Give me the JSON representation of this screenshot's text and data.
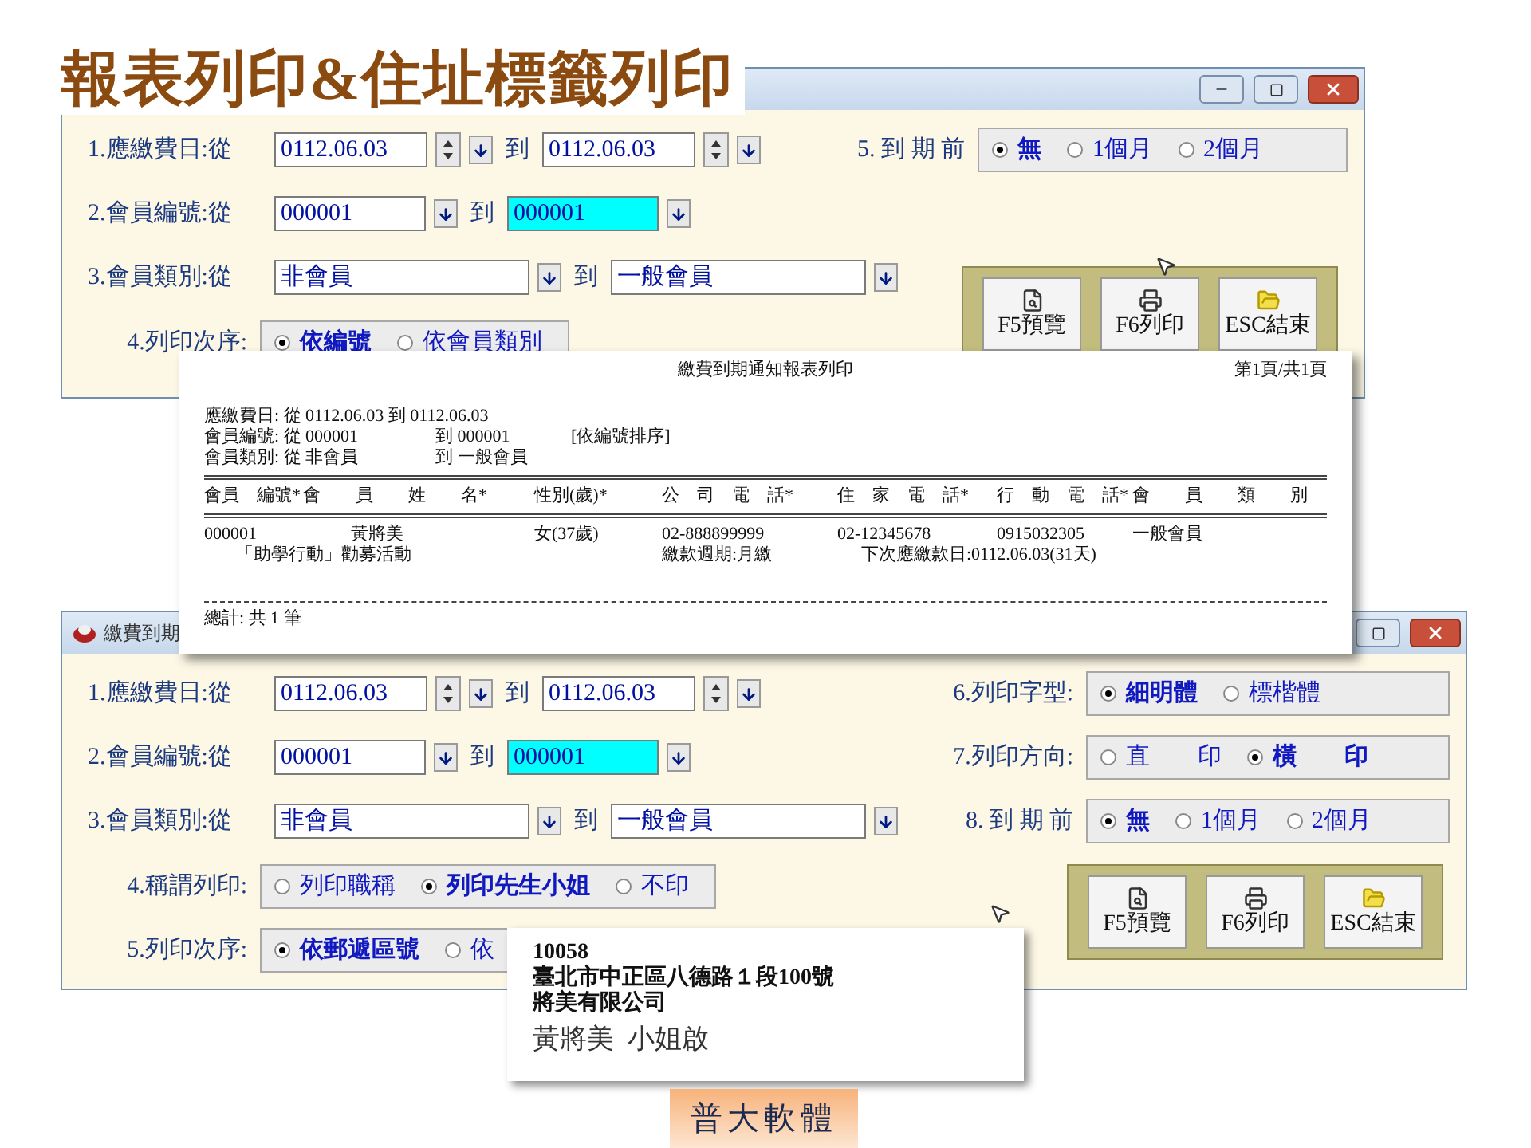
{
  "slide_title": "報表列印&住址標籤列印",
  "top_window": {
    "ranges": [
      {
        "kind": "date",
        "label": "1.應繳費日:從",
        "from": "0112.06.03",
        "joiner": "到",
        "to": "0112.06.03",
        "to_focused": false
      },
      {
        "kind": "code",
        "label": "2.會員編號:從",
        "from": "000001",
        "joiner": "到",
        "to": "000001",
        "to_focused": true
      },
      {
        "kind": "category",
        "label": "3.會員類別:從",
        "from": "非會員",
        "joiner": "到",
        "to": "一般會員",
        "to_focused": false
      }
    ],
    "right_groups": [
      {
        "label": "5. 到 期 前",
        "options": [
          {
            "label": "無",
            "selected": true
          },
          {
            "label": "1個月",
            "selected": false
          },
          {
            "label": "2個月",
            "selected": false
          }
        ]
      }
    ],
    "left_groups": [
      {
        "label": "4.列印次序:",
        "options": [
          {
            "label": "依編號",
            "selected": true
          },
          {
            "label": "依會員類別",
            "selected": false
          }
        ]
      }
    ],
    "buttons": [
      {
        "kind": "preview",
        "label": "F5預覽"
      },
      {
        "kind": "print",
        "label": "F6列印"
      },
      {
        "kind": "exit",
        "label": "ESC結束"
      }
    ]
  },
  "report": {
    "title": "繳費到期通知報表列印",
    "page": "第1頁/共1頁",
    "criteria": [
      [
        "應繳費日: 從 0112.06.03 到 0112.06.03"
      ],
      [
        "會員編號: 從 000001",
        "到 000001",
        "[依編號排序]"
      ],
      [
        "會員類別: 從 非會員",
        "到 一般會員"
      ]
    ],
    "columns": [
      "會員　編號*",
      "會　　員　　姓　　名*",
      "性別(歲)*",
      "公　司　電　話*",
      "住　家　電　話*",
      "行　動　電　話*",
      "會　　員　　類　　別"
    ],
    "row": [
      "000001",
      "黃將美",
      "女(37歲)",
      "02-888899999",
      "02-12345678",
      "0915032305",
      "一般會員"
    ],
    "row_notes": [
      "「助學行動」勸募活動",
      "繳款週期:月繳",
      "下次應繳款日:0112.06.03(31天)"
    ],
    "total": "總計: 共 1 筆"
  },
  "bottom_window": {
    "title": "繳費到期",
    "ranges": [
      {
        "kind": "date",
        "label": "1.應繳費日:從",
        "from": "0112.06.03",
        "joiner": "到",
        "to": "0112.06.03",
        "to_focused": false
      },
      {
        "kind": "code",
        "label": "2.會員編號:從",
        "from": "000001",
        "joiner": "到",
        "to": "000001",
        "to_focused": true
      },
      {
        "kind": "category",
        "label": "3.會員類別:從",
        "from": "非會員",
        "joiner": "到",
        "to": "一般會員",
        "to_focused": false
      }
    ],
    "right_groups": [
      {
        "label": "6.列印字型:",
        "options": [
          {
            "label": "細明體",
            "selected": true
          },
          {
            "label": "標楷體",
            "selected": false
          }
        ]
      },
      {
        "label": "7.列印方向:",
        "options": [
          {
            "label": "直　　印",
            "selected": false
          },
          {
            "label": "橫　　印",
            "selected": true
          }
        ]
      },
      {
        "label": "8. 到 期 前",
        "options": [
          {
            "label": "無",
            "selected": true
          },
          {
            "label": "1個月",
            "selected": false
          },
          {
            "label": "2個月",
            "selected": false
          }
        ]
      }
    ],
    "left_groups": [
      {
        "label": "4.稱謂列印:",
        "options": [
          {
            "label": "列印職稱",
            "selected": false
          },
          {
            "label": "列印先生小姐",
            "selected": true
          },
          {
            "label": "不印",
            "selected": false
          }
        ]
      },
      {
        "label": "5.列印次序:",
        "options": [
          {
            "label": "依郵遞區號",
            "selected": true
          },
          {
            "label": "依",
            "selected": false
          }
        ]
      }
    ],
    "buttons": [
      {
        "kind": "preview",
        "label": "F5預覽"
      },
      {
        "kind": "print",
        "label": "F6列印"
      },
      {
        "kind": "exit",
        "label": "ESC結束"
      }
    ]
  },
  "address_label": {
    "lines": [
      {
        "kind": "address",
        "text": "10058"
      },
      {
        "kind": "address",
        "text": "臺北市中正區八德路１段100號"
      },
      {
        "kind": "address",
        "text": "將美有限公司"
      },
      {
        "kind": "recipient",
        "text": "黃將美  小姐啟"
      }
    ]
  },
  "footer_logo": "普大軟體"
}
